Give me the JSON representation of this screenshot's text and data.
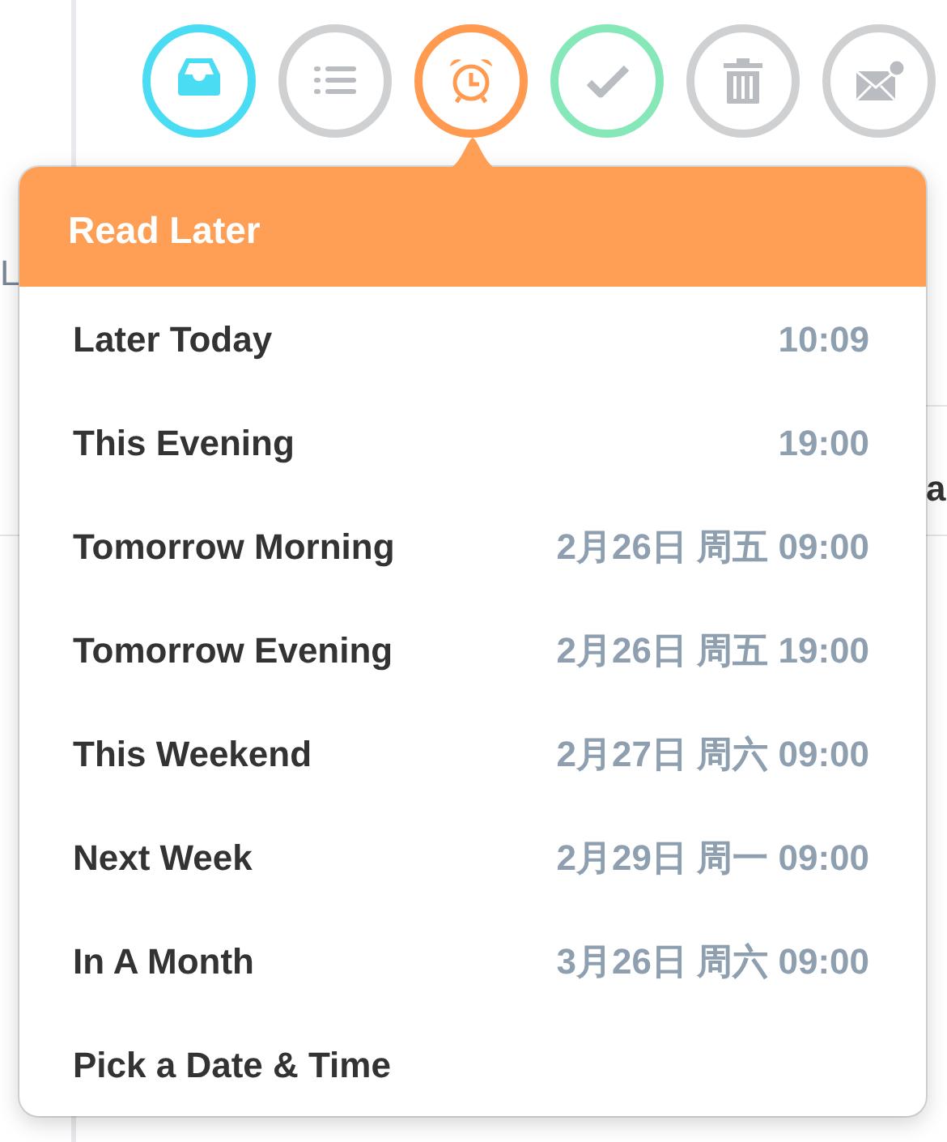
{
  "toolbar": [
    {
      "kind": "inbox",
      "color": "#4adcf2",
      "tinted": true
    },
    {
      "kind": "list",
      "color": "#cfd0d2",
      "tinted": false
    },
    {
      "kind": "alarm",
      "color": "#ff9a50",
      "tinted": true
    },
    {
      "kind": "check",
      "color": "#86e8b8",
      "tinted": false
    },
    {
      "kind": "trash",
      "color": "#cfd0d2",
      "tinted": false
    },
    {
      "kind": "mail",
      "color": "#cfd0d2",
      "tinted": false
    }
  ],
  "background_fragments": [
    "L",
    "a"
  ],
  "popover": {
    "title": "Read Later",
    "items": [
      {
        "label": "Later Today",
        "time": "10:09"
      },
      {
        "label": "This Evening",
        "time": "19:00"
      },
      {
        "label": "Tomorrow Morning",
        "time": "2月26日 周五 09:00"
      },
      {
        "label": "Tomorrow Evening",
        "time": "2月26日 周五 19:00"
      },
      {
        "label": "This Weekend",
        "time": "2月27日 周六 09:00"
      },
      {
        "label": "Next Week",
        "time": "2月29日 周一 09:00"
      },
      {
        "label": "In A Month",
        "time": "3月26日 周六 09:00"
      },
      {
        "label": "Pick a Date & Time"
      }
    ]
  }
}
